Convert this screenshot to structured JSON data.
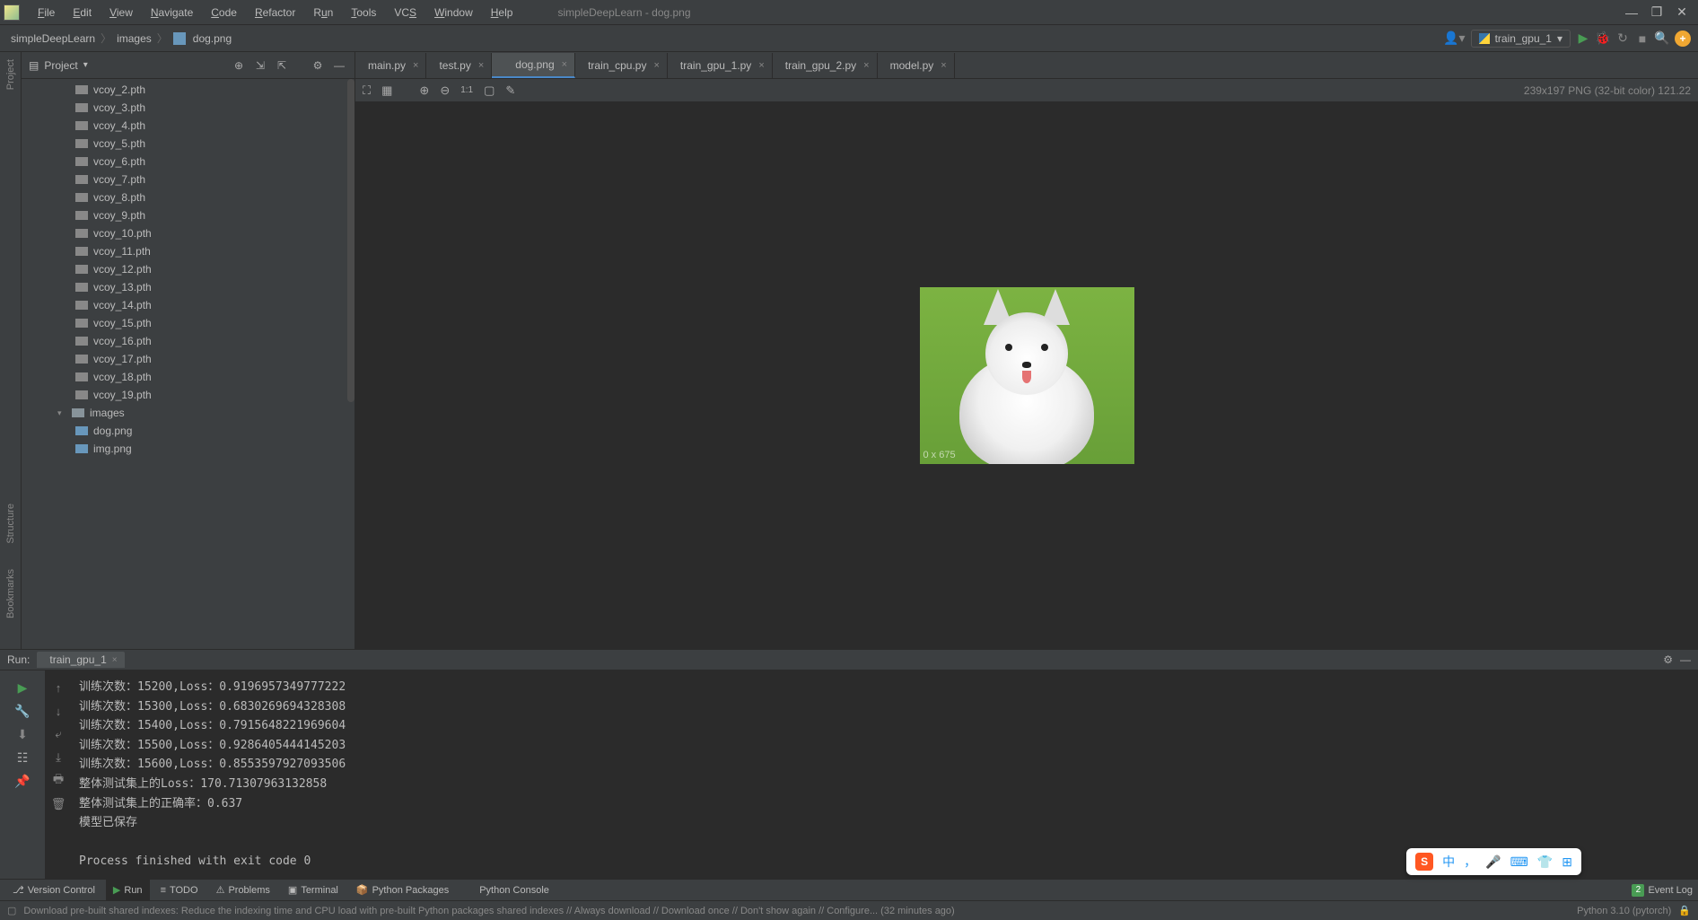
{
  "window_title": "simpleDeepLearn - dog.png",
  "menubar": [
    "File",
    "Edit",
    "View",
    "Navigate",
    "Code",
    "Refactor",
    "Run",
    "Tools",
    "VCS",
    "Window",
    "Help"
  ],
  "breadcrumbs": [
    "simpleDeepLearn",
    "images",
    "dog.png"
  ],
  "run_config": "train_gpu_1",
  "left_tools": [
    "Project",
    "Structure",
    "Bookmarks"
  ],
  "project_panel_title": "Project",
  "tree_files": [
    "vcoy_2.pth",
    "vcoy_3.pth",
    "vcoy_4.pth",
    "vcoy_5.pth",
    "vcoy_6.pth",
    "vcoy_7.pth",
    "vcoy_8.pth",
    "vcoy_9.pth",
    "vcoy_10.pth",
    "vcoy_11.pth",
    "vcoy_12.pth",
    "vcoy_13.pth",
    "vcoy_14.pth",
    "vcoy_15.pth",
    "vcoy_16.pth",
    "vcoy_17.pth",
    "vcoy_18.pth",
    "vcoy_19.pth"
  ],
  "tree_folder": "images",
  "tree_images": [
    "dog.png",
    "img.png"
  ],
  "editor_tabs": [
    {
      "label": "main.py",
      "type": "py"
    },
    {
      "label": "test.py",
      "type": "py"
    },
    {
      "label": "dog.png",
      "type": "img",
      "active": true
    },
    {
      "label": "train_cpu.py",
      "type": "py"
    },
    {
      "label": "train_gpu_1.py",
      "type": "py"
    },
    {
      "label": "train_gpu_2.py",
      "type": "py"
    },
    {
      "label": "model.py",
      "type": "py"
    }
  ],
  "image_status": "239x197 PNG (32-bit color) 121.22",
  "image_watermark": "0 x 675",
  "run_label": "Run:",
  "run_tab": "train_gpu_1",
  "console_lines": [
    "训练次数：15200,Loss：0.9196957349777222",
    "训练次数：15300,Loss：0.6830269694328308",
    "训练次数：15400,Loss：0.7915648221969604",
    "训练次数：15500,Loss：0.9286405444145203",
    "训练次数：15600,Loss：0.8553597927093506",
    "整体测试集上的Loss：170.71307963132858",
    "整体测试集上的正确率：0.637",
    "模型已保存",
    "",
    "Process finished with exit code 0"
  ],
  "bottom_tabs": [
    "Version Control",
    "Run",
    "TODO",
    "Problems",
    "Terminal",
    "Python Packages",
    "Python Console"
  ],
  "event_log": "Event Log",
  "event_count": "2",
  "status_msg": "Download pre-built shared indexes: Reduce the indexing time and CPU load with pre-built Python packages shared indexes // Always download // Download once // Don't show again // Configure... (32 minutes ago)",
  "interpreter": "Python 3.10 (pytorch)",
  "ime": [
    "中",
    "，",
    "🎤",
    "⌨",
    "👕",
    "⊞"
  ]
}
